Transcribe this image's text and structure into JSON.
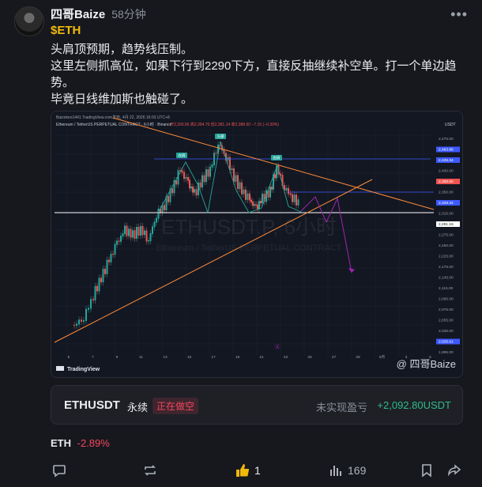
{
  "author": {
    "name": "四哥Baize",
    "time": "58分钟"
  },
  "post": {
    "ticker": "$ETH",
    "lines": [
      "头肩顶预期，趋势线压制。",
      "这里左侧抓高位，如果下行到2290下方，直接反抽继续补空单。打一个单边趋势。",
      "毕竟日线维加斯也触碰了。"
    ]
  },
  "chart": {
    "header_left": "Baizekeo1441 TradingView.com发布, 4月 22, 2026 16:03 UTC+8",
    "symbol_line": "Ethereum / TetherUS PERPETUAL CONTRACT · 6小时 · Binance",
    "ohlc": "开2,393.56 高2,394.76 低2,381.14 收2,388.60 −7.15 (−0.30%)",
    "watermark": "ETHUSDT.P, 6小时",
    "watermark_sub": "Ethereum / TetherUS PERPETUAL CONTRACT",
    "tag_head": "头部",
    "tag_left": "左肩",
    "tag_right": "右肩",
    "currency": "USDT",
    "price_labels": [
      "2,475.00",
      "2,463.86",
      "2,425.34",
      "2,400.00",
      "2,388.60",
      "2,350.00",
      "2,328.34",
      "2,315.00",
      "2,291.15",
      "2,275.00",
      "2,250.00",
      "2,225.00",
      "2,175.00",
      "2,145.00",
      "2,115.00",
      "2,095.00",
      "2,075.00",
      "2,055.00",
      "2,035.00",
      "2,025.61",
      "1,995.00"
    ],
    "x_labels": [
      "5",
      "7",
      "9",
      "11",
      "13",
      "15",
      "17",
      "19",
      "21",
      "23",
      "25",
      "27",
      "29",
      "5月",
      "3",
      "5"
    ],
    "brand": "TradingView",
    "signature": "@ 四哥Baize"
  },
  "position": {
    "symbol": "ETHUSDT",
    "type": "永续",
    "status": "正在做空",
    "pnl_label": "未实现盈亏",
    "pnl_value": "+2,092.80USDT"
  },
  "coin": {
    "symbol": "ETH",
    "change": "-2.89%"
  },
  "actions": {
    "likes": "1",
    "views": "169"
  },
  "colors": {
    "accent": "#f0b90b",
    "up": "#26a69a",
    "down": "#ef5350",
    "positive": "#2ebd85",
    "negative": "#f6465d"
  }
}
